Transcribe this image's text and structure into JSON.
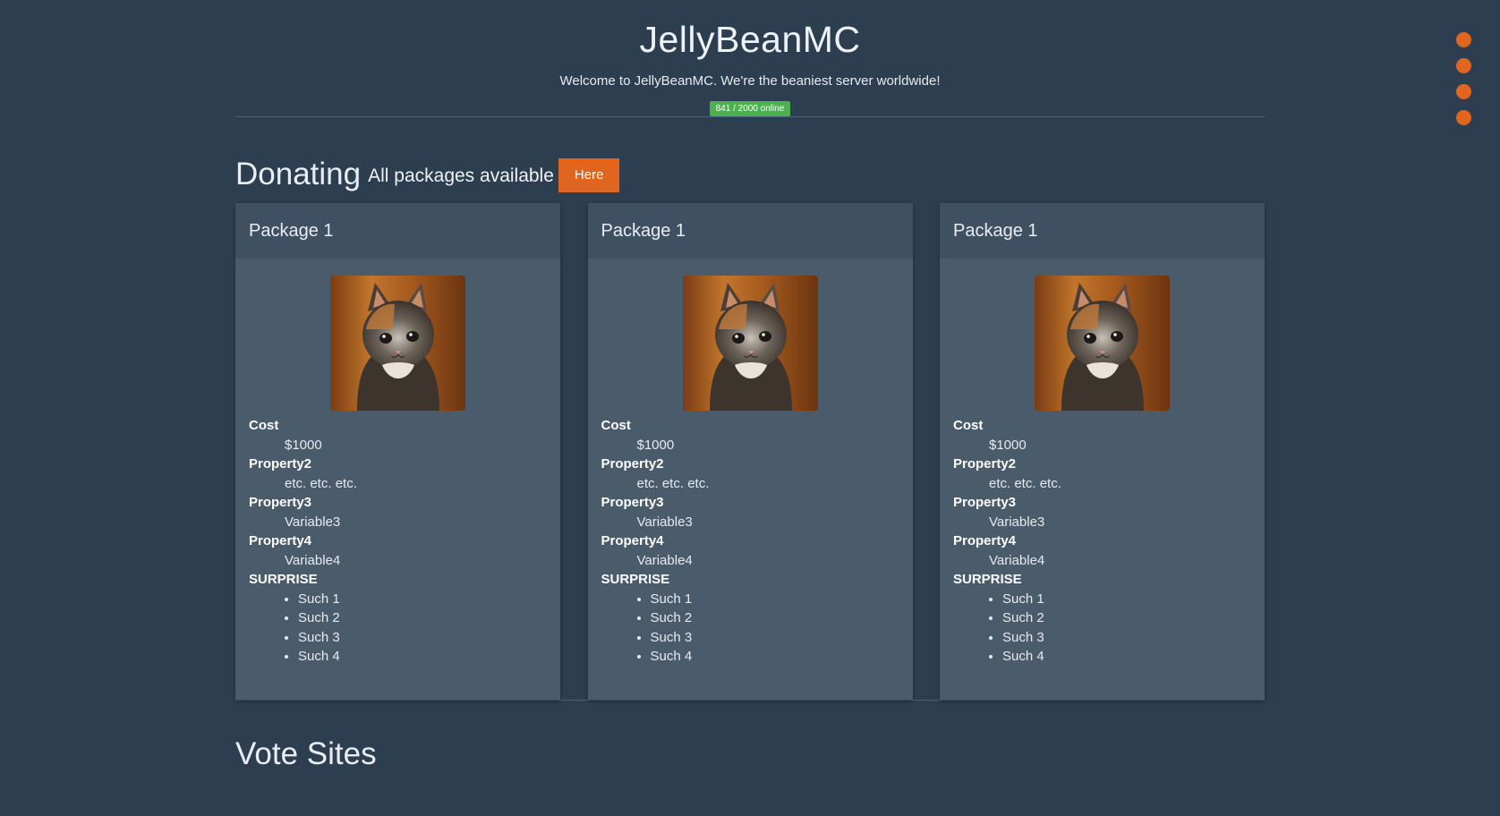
{
  "header": {
    "title": "JellyBeanMC",
    "welcome": "Welcome to JellyBeanMC. We're the beaniest server worldwide!",
    "online_status": "841 / 2000 online"
  },
  "donating": {
    "title": "Donating",
    "subtitle": "All packages available",
    "button_label": "Here"
  },
  "packages": [
    {
      "title": "Package 1",
      "image": "kitten-photo",
      "props": [
        {
          "label": "Cost",
          "value": "$1000"
        },
        {
          "label": "Property2",
          "value": "etc. etc. etc."
        },
        {
          "label": "Property3",
          "value": "Variable3"
        },
        {
          "label": "Property4",
          "value": "Variable4"
        }
      ],
      "surprise_label": "SURPRISE",
      "surprise_items": [
        "Such 1",
        "Such 2",
        "Such 3",
        "Such 4"
      ]
    },
    {
      "title": "Package 1",
      "image": "kitten-photo",
      "props": [
        {
          "label": "Cost",
          "value": "$1000"
        },
        {
          "label": "Property2",
          "value": "etc. etc. etc."
        },
        {
          "label": "Property3",
          "value": "Variable3"
        },
        {
          "label": "Property4",
          "value": "Variable4"
        }
      ],
      "surprise_label": "SURPRISE",
      "surprise_items": [
        "Such 1",
        "Such 2",
        "Such 3",
        "Such 4"
      ]
    },
    {
      "title": "Package 1",
      "image": "kitten-photo",
      "props": [
        {
          "label": "Cost",
          "value": "$1000"
        },
        {
          "label": "Property2",
          "value": "etc. etc. etc."
        },
        {
          "label": "Property3",
          "value": "Variable3"
        },
        {
          "label": "Property4",
          "value": "Variable4"
        }
      ],
      "surprise_label": "SURPRISE",
      "surprise_items": [
        "Such 1",
        "Such 2",
        "Such 3",
        "Such 4"
      ]
    }
  ],
  "vote": {
    "title": "Vote Sites"
  },
  "nav_dots": {
    "count": 4,
    "color": "#e0651e"
  },
  "colors": {
    "background": "#2c3e50",
    "card": "#4a5b6c",
    "card_header": "#3f5063",
    "accent": "#e0651e",
    "online_badge": "#4caf50"
  }
}
